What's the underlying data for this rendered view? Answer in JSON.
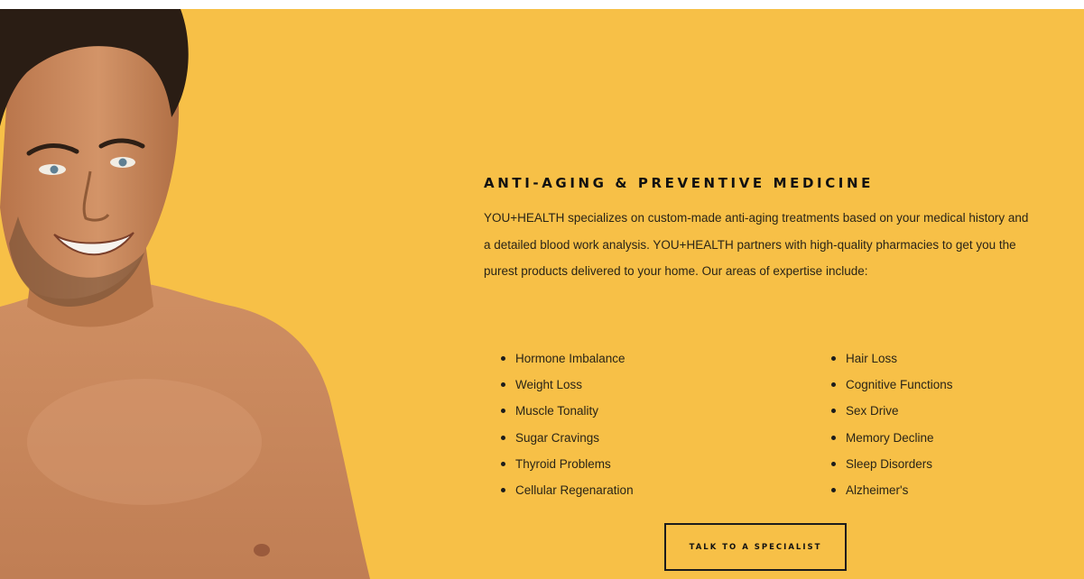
{
  "section": {
    "heading": "ANTI-AGING & PREVENTIVE MEDICINE",
    "intro": "YOU+HEALTH specializes on custom-made anti-aging treatments based on your medical history and a detailed blood work analysis. YOU+HEALTH partners with high-quality pharmacies to get you the purest products delivered to your home. Our areas of expertise include:",
    "expertise_left": [
      "Hormone Imbalance",
      "Weight Loss",
      "Muscle Tonality",
      "Sugar Cravings",
      "Thyroid Problems",
      "Cellular Regenaration"
    ],
    "expertise_right": [
      "Hair Loss",
      "Cognitive Functions",
      "Sex Drive",
      "Memory Decline",
      "Sleep Disorders",
      "Alzheimer's"
    ],
    "cta_label": "TALK TO A SPECIALIST"
  },
  "colors": {
    "background": "#f7c047",
    "text": "#1c1c1c",
    "skin": "#c98a5c"
  },
  "images": {
    "portrait": "smiling-man-portrait"
  }
}
